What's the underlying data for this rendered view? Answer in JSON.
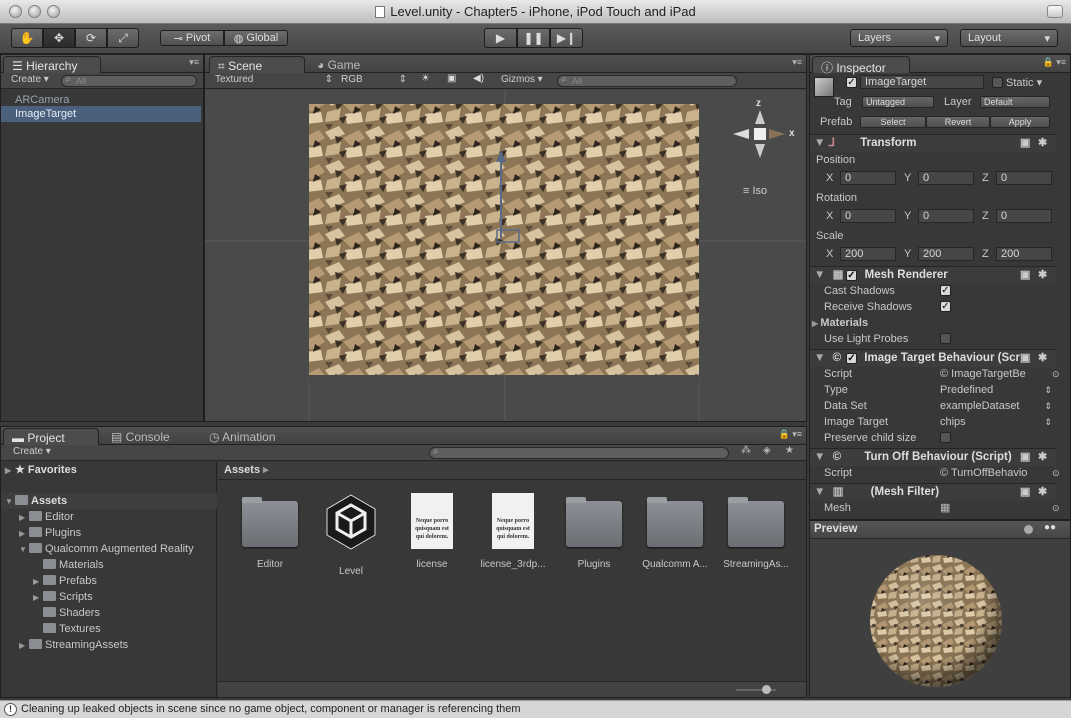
{
  "window": {
    "title": "Level.unity - Chapter5 - iPhone, iPod Touch and iPad"
  },
  "toolbar": {
    "pivot_label": "Pivot",
    "global_label": "Global",
    "layers_label": "Layers",
    "layout_label": "Layout"
  },
  "hierarchy": {
    "tab_label": "Hierarchy",
    "create_label": "Create",
    "search_placeholder": "All",
    "items": [
      {
        "label": "ARCamera"
      },
      {
        "label": "ImageTarget"
      }
    ]
  },
  "scene": {
    "tab_scene": "Scene",
    "tab_game": "Game",
    "render_mode": "Textured",
    "color_mode": "RGB",
    "gizmos_label": "Gizmos",
    "search_placeholder": "All",
    "gizmo_y": "z",
    "gizmo_x": "x",
    "iso_label": "Iso"
  },
  "project": {
    "tab_project": "Project",
    "tab_console": "Console",
    "tab_animation": "Animation",
    "create_label": "Create",
    "favorites_label": "Favorites",
    "assets_label": "Assets",
    "breadcrumb": "Assets",
    "tree": [
      {
        "label": "Editor"
      },
      {
        "label": "Plugins"
      },
      {
        "label": "Qualcomm Augmented Reality"
      },
      {
        "label": "Materials"
      },
      {
        "label": "Prefabs"
      },
      {
        "label": "Scripts"
      },
      {
        "label": "Shaders"
      },
      {
        "label": "Textures"
      },
      {
        "label": "StreamingAssets"
      }
    ],
    "assets": [
      {
        "label": "Editor"
      },
      {
        "label": "Level"
      },
      {
        "label": "license"
      },
      {
        "label": "license_3rdp..."
      },
      {
        "label": "Plugins"
      },
      {
        "label": "Qualcomm A..."
      },
      {
        "label": "StreamingAs..."
      }
    ],
    "doc_text": "Neque porro quisquam est qui dolorem."
  },
  "inspector": {
    "tab_label": "Inspector",
    "object_name": "ImageTarget",
    "static_label": "Static",
    "tag_label": "Tag",
    "tag_value": "Untagged",
    "layer_label": "Layer",
    "layer_value": "Default",
    "prefab_label": "Prefab",
    "select_label": "Select",
    "revert_label": "Revert",
    "apply_label": "Apply",
    "transform": {
      "title": "Transform",
      "position_label": "Position",
      "rotation_label": "Rotation",
      "scale_label": "Scale",
      "x_label": "X",
      "y_label": "Y",
      "z_label": "Z",
      "position": {
        "x": "0",
        "y": "0",
        "z": "0"
      },
      "rotation": {
        "x": "0",
        "y": "0",
        "z": "0"
      },
      "scale": {
        "x": "200",
        "y": "200",
        "z": "200"
      }
    },
    "mesh_renderer": {
      "title": "Mesh Renderer",
      "cast_shadows": "Cast Shadows",
      "receive_shadows": "Receive Shadows",
      "materials": "Materials",
      "light_probes": "Use Light Probes"
    },
    "itb": {
      "title": "Image Target Behaviour (Scr",
      "script_label": "Script",
      "script_value": "ImageTargetBe",
      "type_label": "Type",
      "type_value": "Predefined",
      "dataset_label": "Data Set",
      "dataset_value": "exampleDataset",
      "target_label": "Image Target",
      "target_value": "chips",
      "preserve_label": "Preserve child size"
    },
    "turnoff": {
      "title": "Turn Off Behaviour (Script)",
      "script_label": "Script",
      "script_value": "TurnOffBehavio"
    },
    "meshfilter": {
      "title": "(Mesh Filter)",
      "mesh_label": "Mesh"
    },
    "preview_label": "Preview"
  },
  "status": {
    "message": "Cleaning up leaked objects in scene since no game object, component or manager is referencing them"
  },
  "colors": {
    "selection": "#4a607c",
    "texture_light": "#b59a74",
    "texture_dark": "#3b3026"
  }
}
